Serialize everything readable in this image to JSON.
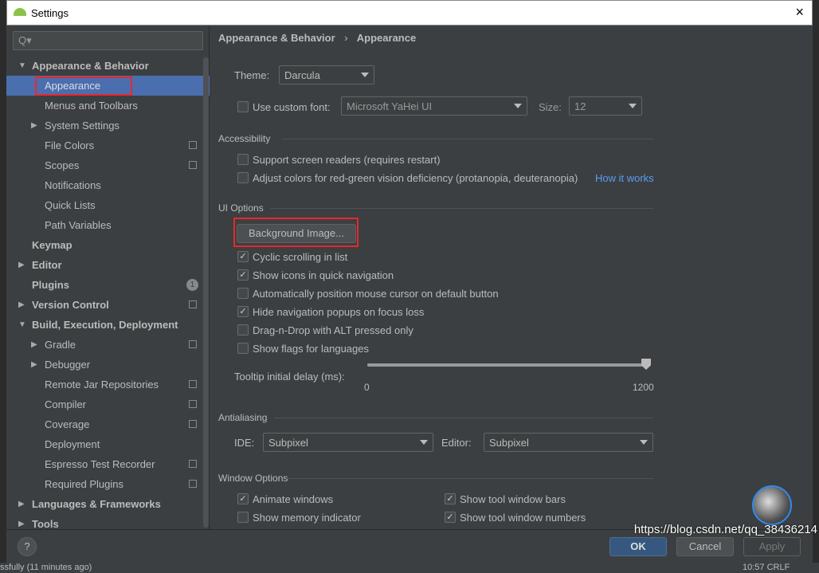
{
  "window": {
    "title": "Settings",
    "close": "×"
  },
  "sidebar": {
    "search_placeholder": "Q▾",
    "items": [
      {
        "label": "Appearance & Behavior",
        "bold": true,
        "level": 0,
        "arrow": "▼"
      },
      {
        "label": "Appearance",
        "level": 1,
        "selected": true
      },
      {
        "label": "Menus and Toolbars",
        "level": 1
      },
      {
        "label": "System Settings",
        "level": 1,
        "arrow": "▶"
      },
      {
        "label": "File Colors",
        "level": 1,
        "project": true
      },
      {
        "label": "Scopes",
        "level": 1,
        "project": true
      },
      {
        "label": "Notifications",
        "level": 1
      },
      {
        "label": "Quick Lists",
        "level": 1
      },
      {
        "label": "Path Variables",
        "level": 1
      },
      {
        "label": "Keymap",
        "bold": true,
        "level": 0
      },
      {
        "label": "Editor",
        "bold": true,
        "level": 0,
        "arrow": "▶"
      },
      {
        "label": "Plugins",
        "bold": true,
        "level": 0,
        "badge": "1"
      },
      {
        "label": "Version Control",
        "bold": true,
        "level": 0,
        "arrow": "▶",
        "project": true
      },
      {
        "label": "Build, Execution, Deployment",
        "bold": true,
        "level": 0,
        "arrow": "▼"
      },
      {
        "label": "Gradle",
        "level": 1,
        "arrow": "▶",
        "project": true
      },
      {
        "label": "Debugger",
        "level": 1,
        "arrow": "▶"
      },
      {
        "label": "Remote Jar Repositories",
        "level": 1,
        "project": true
      },
      {
        "label": "Compiler",
        "level": 1,
        "project": true
      },
      {
        "label": "Coverage",
        "level": 1,
        "project": true
      },
      {
        "label": "Deployment",
        "level": 1
      },
      {
        "label": "Espresso Test Recorder",
        "level": 1,
        "project": true
      },
      {
        "label": "Required Plugins",
        "level": 1,
        "project": true
      },
      {
        "label": "Languages & Frameworks",
        "bold": true,
        "level": 0,
        "arrow": "▶"
      },
      {
        "label": "Tools",
        "bold": true,
        "level": 0,
        "arrow": "▶"
      }
    ]
  },
  "breadcrumb": {
    "parent": "Appearance & Behavior",
    "sep": "›",
    "current": "Appearance"
  },
  "theme": {
    "label": "Theme:",
    "value": "Darcula"
  },
  "font": {
    "label": "Use custom font:",
    "value": "Microsoft YaHei UI",
    "size_label": "Size:",
    "size_value": "12",
    "checked": false
  },
  "accessibility": {
    "title": "Accessibility",
    "options": [
      {
        "label": "Support screen readers (requires restart)",
        "checked": false
      },
      {
        "label": "Adjust colors for red-green vision deficiency (protanopia, deuteranopia)",
        "checked": false
      }
    ],
    "link": "How it works"
  },
  "ui_options": {
    "title": "UI Options",
    "bg_button": "Background Image...",
    "options": [
      {
        "label": "Cyclic scrolling in list",
        "checked": true
      },
      {
        "label": "Show icons in quick navigation",
        "checked": true
      },
      {
        "label": "Automatically position mouse cursor on default button",
        "checked": false
      },
      {
        "label": "Hide navigation popups on focus loss",
        "checked": true
      },
      {
        "label": "Drag-n-Drop with ALT pressed only",
        "checked": false
      },
      {
        "label": "Show flags for languages",
        "checked": false
      }
    ],
    "tooltip": {
      "label": "Tooltip initial delay (ms):",
      "min": "0",
      "max": "1200",
      "value": 1200
    }
  },
  "antialiasing": {
    "title": "Antialiasing",
    "ide_label": "IDE:",
    "ide_value": "Subpixel",
    "editor_label": "Editor:",
    "editor_value": "Subpixel"
  },
  "window_options": {
    "title": "Window Options",
    "options": [
      {
        "label": "Animate windows",
        "checked": true
      },
      {
        "label": "Show tool window bars",
        "checked": true
      },
      {
        "label": "Show memory indicator",
        "checked": false
      },
      {
        "label": "Show tool window numbers",
        "checked": true
      }
    ]
  },
  "footer": {
    "help": "?",
    "ok": "OK",
    "cancel": "Cancel",
    "apply": "Apply"
  },
  "watermark": "https://blog.csdn.net/qq_38436214",
  "statusbar": {
    "left": "ssfully (11 minutes ago)",
    "right": "10:57  CRLF"
  },
  "check_mark": "✓"
}
